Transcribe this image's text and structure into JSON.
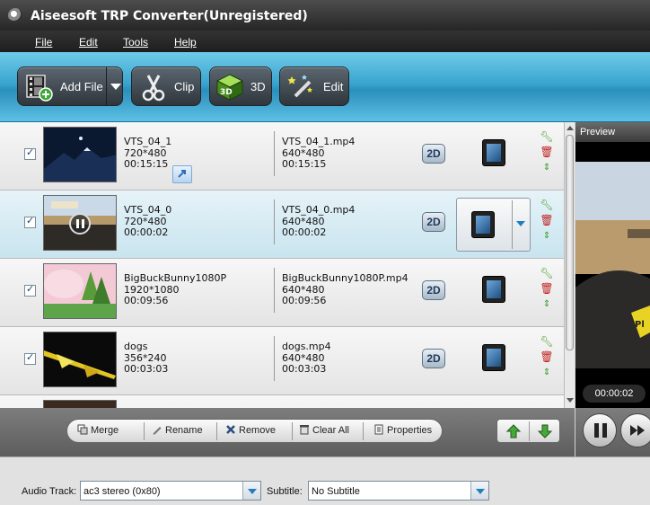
{
  "window": {
    "title": "Aiseesoft TRP Converter(Unregistered)"
  },
  "menu": [
    {
      "label": "File"
    },
    {
      "label": "Edit"
    },
    {
      "label": "Tools"
    },
    {
      "label": "Help"
    }
  ],
  "toolbar": {
    "add_file": "Add File",
    "clip": "Clip",
    "three_d": "3D",
    "edit": "Edit"
  },
  "files": [
    {
      "name": "VTS_04_1",
      "resolution": "720*480",
      "duration": "00:15:15",
      "output_name": "VTS_04_1.mp4",
      "output_resolution": "640*480",
      "output_duration": "00:15:15",
      "mode": "2D",
      "checked": true
    },
    {
      "name": "VTS_04_0",
      "resolution": "720*480",
      "duration": "00:00:02",
      "output_name": "VTS_04_0.mp4",
      "output_resolution": "640*480",
      "output_duration": "00:00:02",
      "mode": "2D",
      "checked": true
    },
    {
      "name": "BigBuckBunny1080P",
      "resolution": "1920*1080",
      "duration": "00:09:56",
      "output_name": "BigBuckBunny1080P.mp4",
      "output_resolution": "640*480",
      "output_duration": "00:09:56",
      "mode": "2D",
      "checked": true
    },
    {
      "name": "dogs",
      "resolution": "356*240",
      "duration": "00:03:03",
      "output_name": "dogs.mp4",
      "output_resolution": "640*480",
      "output_duration": "00:03:03",
      "mode": "2D",
      "checked": true
    }
  ],
  "preview": {
    "label": "Preview",
    "time": "00:00:02",
    "overlay_text": "Pl"
  },
  "actions": {
    "merge": "Merge",
    "rename": "Rename",
    "remove": "Remove",
    "clear_all": "Clear All",
    "properties": "Properties"
  },
  "footer": {
    "audio_track_label": "Audio Track:",
    "audio_track_value": "ac3 stereo (0x80)",
    "subtitle_label": "Subtitle:",
    "subtitle_value": "No Subtitle"
  },
  "colors": {
    "toolbar": "#3aa5cf",
    "accent": "#1e7fc0",
    "titlebar": "#262626"
  }
}
